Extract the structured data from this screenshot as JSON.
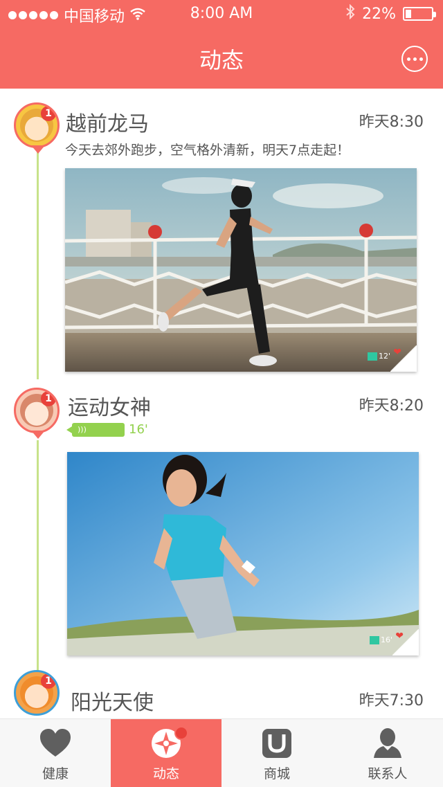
{
  "status_bar": {
    "carrier": "中国移动",
    "time": "8:00 AM",
    "battery": "22%",
    "battery_level": 0.22
  },
  "nav": {
    "title": "动态"
  },
  "posts": [
    {
      "name": "越前龙马",
      "time": "昨天8:30",
      "text": "今天去郊外跑步，空气格外清新，明天7点走起！",
      "badge": "1",
      "photo_duration": "12'"
    },
    {
      "name": "运动女神",
      "time": "昨天8:20",
      "badge": "1",
      "voice_duration": "16'",
      "photo_duration": "16'"
    },
    {
      "name": "阳光天使",
      "time": "昨天7:30",
      "badge": "1"
    }
  ],
  "tabs": [
    {
      "label": "健康",
      "icon": "heart-icon"
    },
    {
      "label": "动态",
      "icon": "compass-icon",
      "active": true
    },
    {
      "label": "商城",
      "icon": "shop-bag-icon"
    },
    {
      "label": "联系人",
      "icon": "person-icon"
    }
  ],
  "colors": {
    "accent": "#f66a63",
    "timeline": "#c7e28a",
    "voice": "#93d14e"
  }
}
